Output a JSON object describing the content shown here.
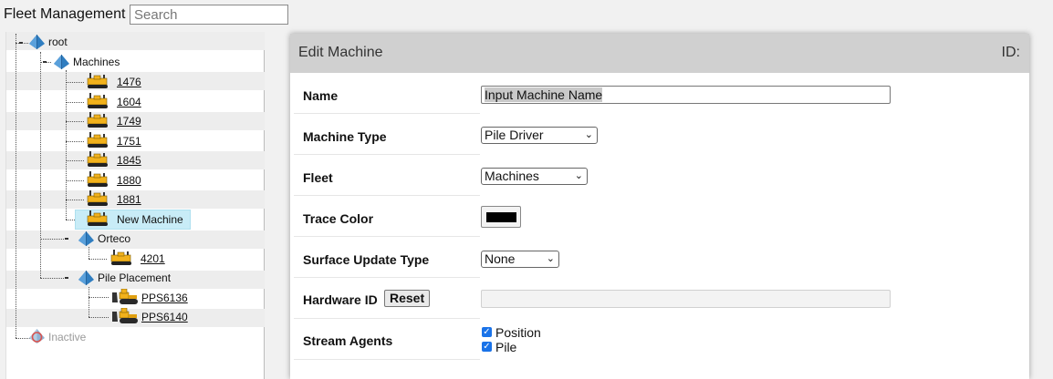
{
  "header": {
    "title": "Fleet Management",
    "search_placeholder": "Search"
  },
  "tree": {
    "root": {
      "label": "root",
      "icon": "pyramid-icon"
    },
    "groups": [
      {
        "label": "Machines",
        "icon": "pyramid-icon",
        "children": [
          {
            "label": "1476",
            "icon": "pile-driver-icon"
          },
          {
            "label": "1604",
            "icon": "pile-driver-icon"
          },
          {
            "label": "1749",
            "icon": "pile-driver-icon"
          },
          {
            "label": "1751",
            "icon": "pile-driver-icon"
          },
          {
            "label": "1845",
            "icon": "pile-driver-icon"
          },
          {
            "label": "1880",
            "icon": "pile-driver-icon"
          },
          {
            "label": "1881",
            "icon": "pile-driver-icon"
          },
          {
            "label": "New Machine",
            "icon": "pile-driver-icon",
            "selected": true
          }
        ]
      },
      {
        "label": "Orteco",
        "icon": "pyramid-icon",
        "children": [
          {
            "label": "4201",
            "icon": "pile-driver-icon"
          }
        ]
      },
      {
        "label": "Pile Placement",
        "icon": "pyramid-icon",
        "children": [
          {
            "label": "PPS6136",
            "icon": "bulldozer-icon"
          },
          {
            "label": "PPS6140",
            "icon": "bulldozer-icon"
          }
        ]
      }
    ],
    "inactive": {
      "label": "Inactive",
      "icon": "inactive-pyramid-icon"
    }
  },
  "edit_panel": {
    "title": "Edit Machine",
    "id_label": "ID:",
    "name": {
      "label": "Name",
      "value": "Input Machine Name"
    },
    "machine_type": {
      "label": "Machine Type",
      "value": "Pile Driver"
    },
    "fleet": {
      "label": "Fleet",
      "value": "Machines"
    },
    "trace_color": {
      "label": "Trace Color",
      "value": "#000000"
    },
    "surface_update_type": {
      "label": "Surface Update Type",
      "value": "None"
    },
    "hardware_id": {
      "label": "Hardware ID",
      "reset_label": "Reset",
      "value": ""
    },
    "stream_agents": {
      "label": "Stream Agents",
      "options": [
        {
          "label": "Position",
          "checked": true
        },
        {
          "label": "Pile",
          "checked": true
        }
      ]
    }
  },
  "colors": {
    "selection": "#c8ecf7",
    "pyramid": "#2f7dc0",
    "machine": "#f2b21c",
    "panel_header": "#d0d0d0",
    "checkbox": "#1a73e8"
  }
}
